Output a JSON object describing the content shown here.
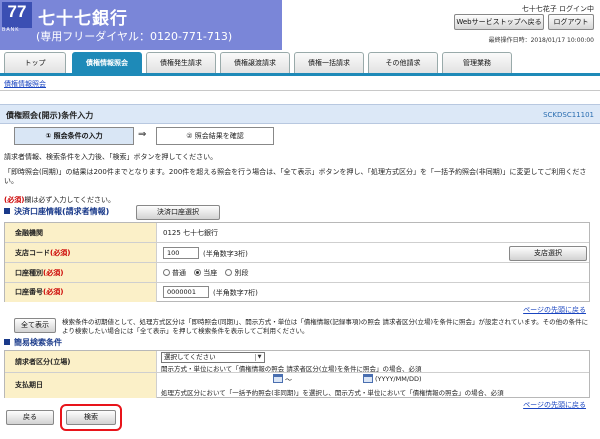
{
  "header": {
    "logo_number": "77",
    "logo_sub": "BANK",
    "bank_name": "七十七銀行",
    "phone": "(専用フリーダイヤル：0120-771-713)",
    "user_name": "七十七花子 ログイン中",
    "web_services_button": "Webサービストップへ戻る",
    "logout_button": "ログアウト",
    "last_operation": "最終操作日時：2018/01/17 10:00:00"
  },
  "nav": {
    "tabs": [
      {
        "label": "トップ",
        "active": false
      },
      {
        "label": "債権情報照会",
        "active": true
      },
      {
        "label": "債権発生請求",
        "active": false
      },
      {
        "label": "債権譲渡請求",
        "active": false
      },
      {
        "label": "債権一括請求",
        "active": false
      },
      {
        "label": "その他請求",
        "active": false
      },
      {
        "label": "管理業務",
        "active": false
      }
    ],
    "sub_item": "債権情報照会"
  },
  "page": {
    "title": "債権照会(開示)条件入力",
    "screen_id": "SCKDSC11101",
    "steps": {
      "current": "① 照会条件の入力",
      "arrow": "⇒",
      "next": "② 照会結果を確認"
    },
    "instruction": "請求者情報、検索条件を入力後、「検索」ボタンを押してください。",
    "warning": "「即時照会(同期)」の結果は200件までとなります。200件を超える照会を行う場合は、「全て表示」ボタンを押し、「処理方式区分」を「一括予約照会(非同期)」に変更してご利用ください。",
    "required_note_tag": "(必須)",
    "required_note_text": "欄は必ず入力してください。",
    "page_top_link": "ページの先頭に戻る"
  },
  "settlement": {
    "section_title": "決済口座情報(請求者情報)",
    "select_button": "決済口座選択",
    "rows": {
      "financial_institution": {
        "label": "金融機関",
        "value": "0125 七十七銀行"
      },
      "branch_code": {
        "label": "支店コード",
        "required": "(必須)",
        "value": "100",
        "hint": "(半角数字3桁)",
        "select_button": "支店選択"
      },
      "account_type": {
        "label": "口座種別",
        "required": "(必須)",
        "options": [
          "普通",
          "当座",
          "別段"
        ],
        "selected": "当座"
      },
      "account_number": {
        "label": "口座番号",
        "required": "(必須)",
        "value": "0000001",
        "hint": "(半角数字7桁)"
      }
    }
  },
  "show_all": {
    "button": "全て表示",
    "note": "検索条件の初期値として、処理方式区分は「即時照会(同期)」、開示方式・単位は「債権情報(記録事項)の照会 請求者区分(立場)を条件に照会」が設定されています。その他の条件により検索したい場合には「全て表示」を押して検索条件を表示してご利用ください。"
  },
  "simple_search": {
    "section_title": "簡易検索条件",
    "requester_type": {
      "label": "請求者区分(立場)",
      "select_value": "選択してください",
      "note": "開示方式・単位において「債権情報の照会 請求者区分(立場)を条件に照会」の場合、必須"
    },
    "payment_date": {
      "label": "支払期日",
      "separator": "～",
      "format_hint": "(YYYY/MM/DD)",
      "note": "処理方式区分において「一括予約照会(非同期)」を選択し、開示方式・単位において「債権情報の照会」の場合、必須"
    }
  },
  "footer": {
    "back_button": "戻る",
    "search_button": "検索"
  },
  "colors": {
    "brand_bg": "#7a86d8",
    "active_tab": "#1e8ab8",
    "highlight_ring": "#e8141a",
    "label_bg": "#fbf0c8"
  }
}
